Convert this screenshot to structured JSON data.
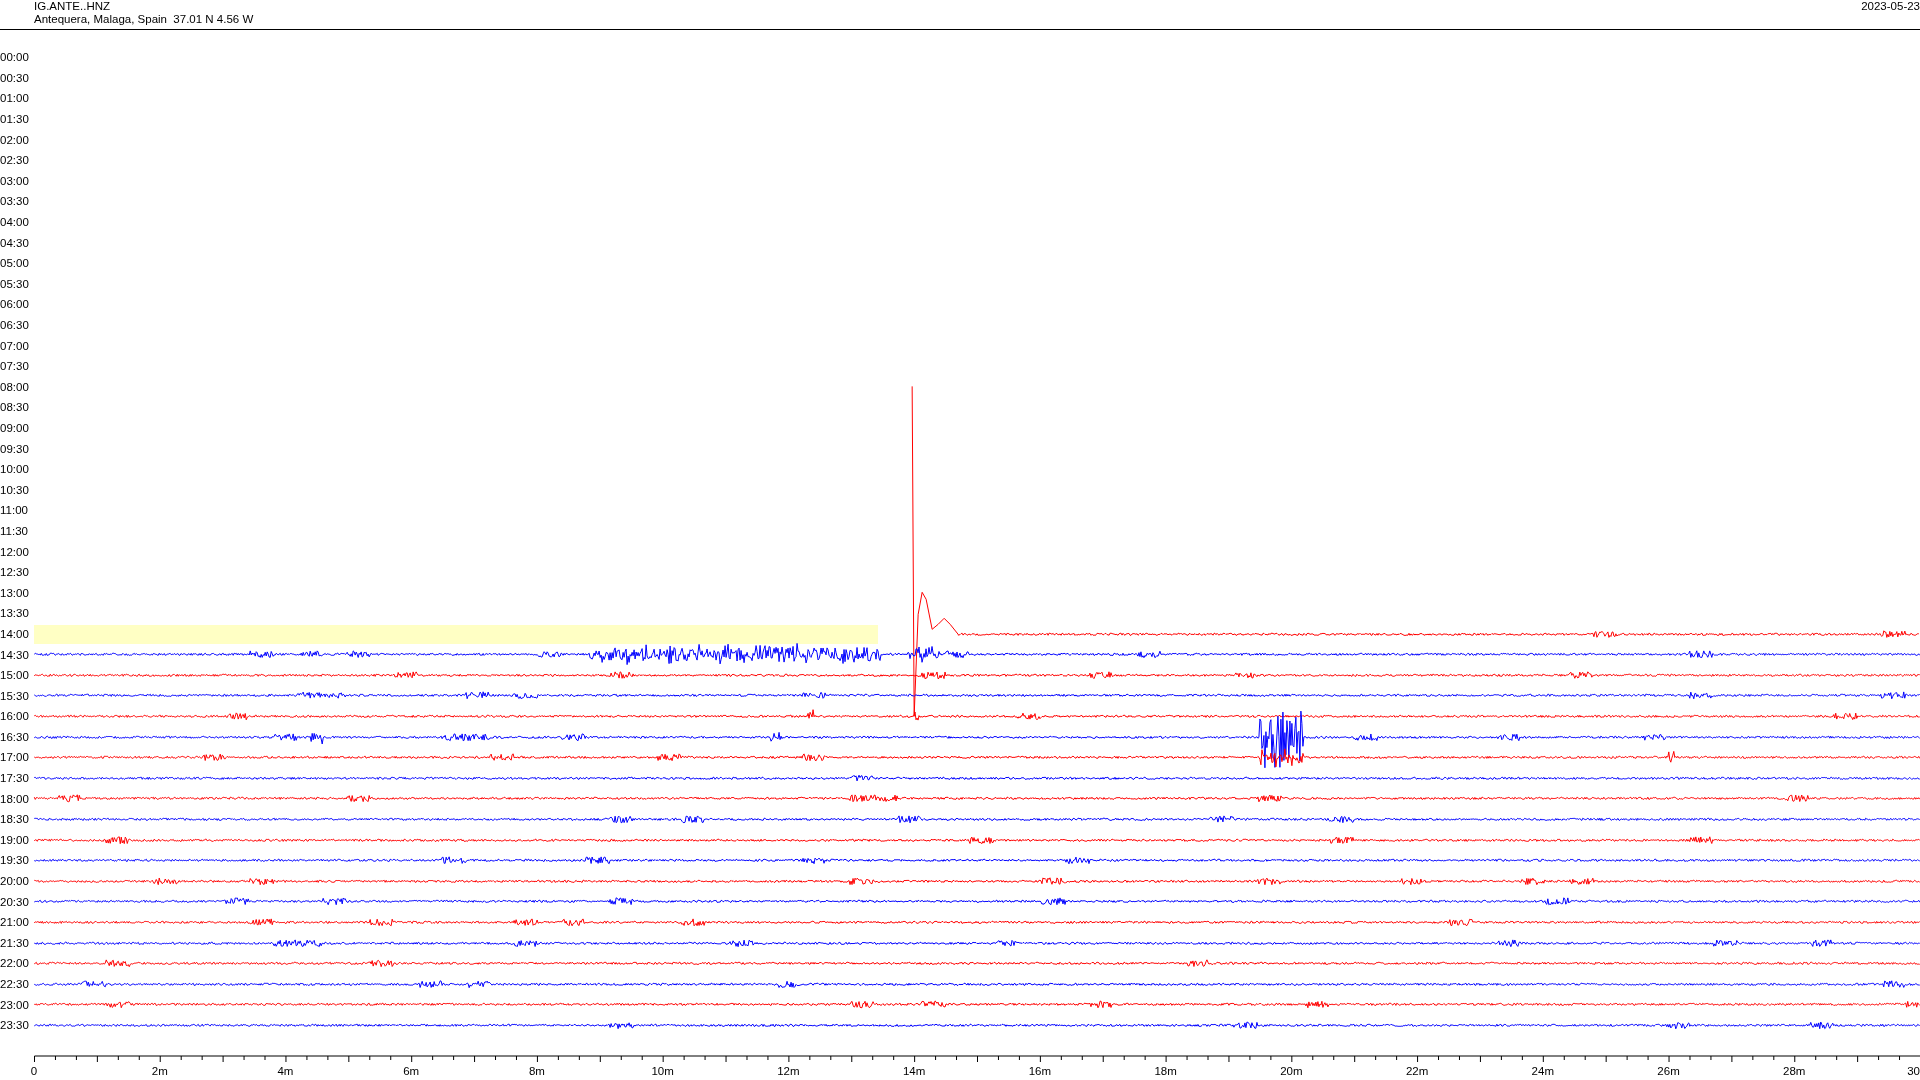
{
  "header": {
    "channel": "IG.ANTE..HNZ",
    "location": "Antequera, Malaga, Spain  37.01 N 4.56 W",
    "date": "2023-05-23"
  },
  "rows": [
    {
      "time": "00:00",
      "kind": "empty",
      "highlighted": false
    },
    {
      "time": "00:30",
      "kind": "empty",
      "highlighted": false
    },
    {
      "time": "01:00",
      "kind": "empty",
      "highlighted": false
    },
    {
      "time": "01:30",
      "kind": "empty",
      "highlighted": false
    },
    {
      "time": "02:00",
      "kind": "empty",
      "highlighted": false
    },
    {
      "time": "02:30",
      "kind": "empty",
      "highlighted": false
    },
    {
      "time": "03:00",
      "kind": "empty",
      "highlighted": false
    },
    {
      "time": "03:30",
      "kind": "empty",
      "highlighted": false
    },
    {
      "time": "04:00",
      "kind": "empty",
      "highlighted": false
    },
    {
      "time": "04:30",
      "kind": "empty",
      "highlighted": false
    },
    {
      "time": "05:00",
      "kind": "empty",
      "highlighted": false
    },
    {
      "time": "05:30",
      "kind": "empty",
      "highlighted": false
    },
    {
      "time": "06:00",
      "kind": "empty",
      "highlighted": false
    },
    {
      "time": "06:30",
      "kind": "empty",
      "highlighted": false
    },
    {
      "time": "07:00",
      "kind": "empty",
      "highlighted": false
    },
    {
      "time": "07:30",
      "kind": "empty",
      "highlighted": false
    },
    {
      "time": "08:00",
      "kind": "empty",
      "highlighted": false
    },
    {
      "time": "08:30",
      "kind": "empty",
      "highlighted": false
    },
    {
      "time": "09:00",
      "kind": "empty",
      "highlighted": false
    },
    {
      "time": "09:30",
      "kind": "empty",
      "highlighted": false
    },
    {
      "time": "10:00",
      "kind": "empty",
      "highlighted": false
    },
    {
      "time": "10:30",
      "kind": "empty",
      "highlighted": false
    },
    {
      "time": "11:00",
      "kind": "empty",
      "highlighted": false
    },
    {
      "time": "11:30",
      "kind": "empty",
      "highlighted": false
    },
    {
      "time": "12:00",
      "kind": "empty",
      "highlighted": false
    },
    {
      "time": "12:30",
      "kind": "empty",
      "highlighted": false
    },
    {
      "time": "13:00",
      "kind": "empty",
      "highlighted": false
    },
    {
      "time": "13:30",
      "kind": "empty",
      "highlighted": false
    },
    {
      "time": "14:00",
      "kind": "partial",
      "highlighted": true,
      "color": "#ff0000"
    },
    {
      "time": "14:30",
      "kind": "trace",
      "highlighted": false,
      "color": "#0000ff"
    },
    {
      "time": "15:00",
      "kind": "trace",
      "highlighted": false,
      "color": "#ff0000"
    },
    {
      "time": "15:30",
      "kind": "trace",
      "highlighted": false,
      "color": "#0000ff"
    },
    {
      "time": "16:00",
      "kind": "trace",
      "highlighted": false,
      "color": "#ff0000"
    },
    {
      "time": "16:30",
      "kind": "trace",
      "highlighted": false,
      "color": "#0000ff"
    },
    {
      "time": "17:00",
      "kind": "trace",
      "highlighted": false,
      "color": "#ff0000"
    },
    {
      "time": "17:30",
      "kind": "trace",
      "highlighted": false,
      "color": "#0000ff"
    },
    {
      "time": "18:00",
      "kind": "trace",
      "highlighted": false,
      "color": "#ff0000"
    },
    {
      "time": "18:30",
      "kind": "trace",
      "highlighted": false,
      "color": "#0000ff"
    },
    {
      "time": "19:00",
      "kind": "trace",
      "highlighted": false,
      "color": "#ff0000"
    },
    {
      "time": "19:30",
      "kind": "trace",
      "highlighted": false,
      "color": "#0000ff"
    },
    {
      "time": "20:00",
      "kind": "trace",
      "highlighted": false,
      "color": "#ff0000"
    },
    {
      "time": "20:30",
      "kind": "trace",
      "highlighted": false,
      "color": "#0000ff"
    },
    {
      "time": "21:00",
      "kind": "trace",
      "highlighted": false,
      "color": "#ff0000"
    },
    {
      "time": "21:30",
      "kind": "trace",
      "highlighted": false,
      "color": "#0000ff"
    },
    {
      "time": "22:00",
      "kind": "trace",
      "highlighted": false,
      "color": "#ff0000"
    },
    {
      "time": "22:30",
      "kind": "trace",
      "highlighted": false,
      "color": "#0000ff"
    },
    {
      "time": "23:00",
      "kind": "trace",
      "highlighted": false,
      "color": "#ff0000"
    },
    {
      "time": "23:30",
      "kind": "trace",
      "highlighted": false,
      "color": "#0000ff"
    }
  ],
  "x_axis": {
    "labels": [
      "0",
      "2m",
      "4m",
      "6m",
      "8m",
      "10m",
      "12m",
      "14m",
      "16m",
      "18m",
      "20m",
      "22m",
      "24m",
      "26m",
      "28m",
      "30"
    ]
  }
}
